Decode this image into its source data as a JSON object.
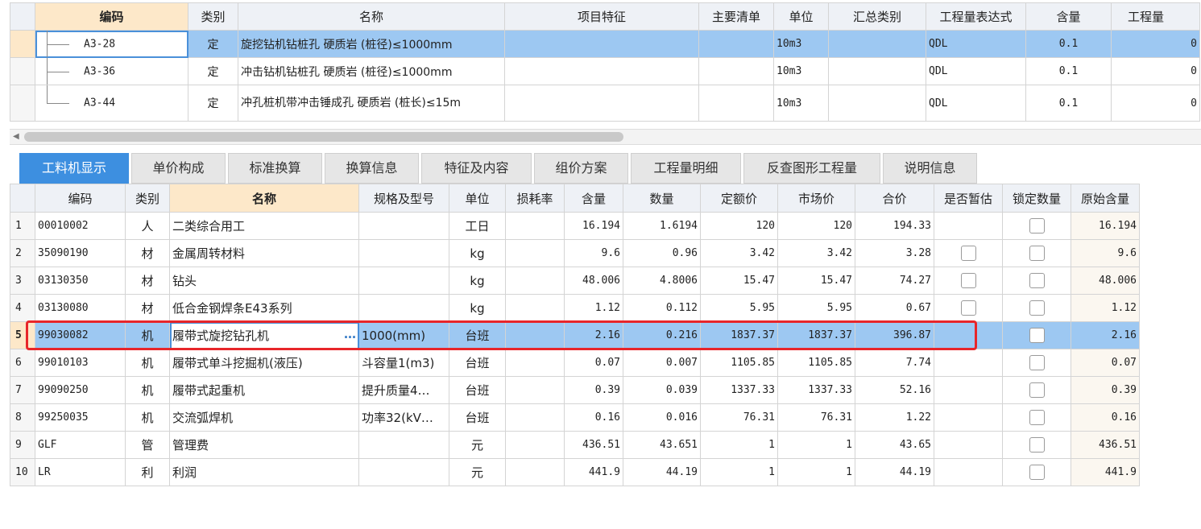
{
  "top_grid": {
    "headers": [
      "编码",
      "类别",
      "名称",
      "项目特征",
      "主要清单",
      "单位",
      "汇总类别",
      "工程量表达式",
      "含量",
      "工程量"
    ],
    "rows": [
      {
        "code": "A3-28",
        "type": "定",
        "name": "旋挖钻机钻桩孔 硬质岩 (桩径)≤1000mm",
        "feature": "",
        "main": "",
        "unit": "10m3",
        "summary": "",
        "expr": "QDL",
        "content": "0.1",
        "qty": "0"
      },
      {
        "code": "A3-36",
        "type": "定",
        "name": "冲击钻机钻桩孔 硬质岩 (桩径)≤1000mm",
        "feature": "",
        "main": "",
        "unit": "10m3",
        "summary": "",
        "expr": "QDL",
        "content": "0.1",
        "qty": "0"
      },
      {
        "code": "A3-44",
        "type": "定",
        "name": "冲孔桩机带冲击锤成孔 硬质岩 (桩长)≤15m",
        "feature": "",
        "main": "",
        "unit": "10m3",
        "summary": "",
        "expr": "QDL",
        "content": "0.1",
        "qty": "0"
      }
    ]
  },
  "tabs": [
    "工料机显示",
    "单价构成",
    "标准换算",
    "换算信息",
    "特征及内容",
    "组价方案",
    "工程量明细",
    "反查图形工程量",
    "说明信息"
  ],
  "bottom_grid": {
    "headers": [
      "编码",
      "类别",
      "名称",
      "规格及型号",
      "单位",
      "损耗率",
      "含量",
      "数量",
      "定额价",
      "市场价",
      "合价",
      "是否暂估",
      "锁定数量",
      "原始含量"
    ],
    "rows": [
      {
        "n": "1",
        "code": "00010002",
        "type": "人",
        "name": "二类综合用工",
        "spec": "",
        "unit": "工日",
        "loss": "",
        "content": "16.194",
        "qty": "1.6194",
        "quota": "120",
        "market": "120",
        "total": "194.33",
        "est": false,
        "lock": true,
        "orig": "16.194"
      },
      {
        "n": "2",
        "code": "35090190",
        "type": "材",
        "name": "金属周转材料",
        "spec": "",
        "unit": "kg",
        "loss": "",
        "content": "9.6",
        "qty": "0.96",
        "quota": "3.42",
        "market": "3.42",
        "total": "3.28",
        "est": true,
        "lock": true,
        "orig": "9.6"
      },
      {
        "n": "3",
        "code": "03130350",
        "type": "材",
        "name": "钻头",
        "spec": "",
        "unit": "kg",
        "loss": "",
        "content": "48.006",
        "qty": "4.8006",
        "quota": "15.47",
        "market": "15.47",
        "total": "74.27",
        "est": true,
        "lock": true,
        "orig": "48.006"
      },
      {
        "n": "4",
        "code": "03130080",
        "type": "材",
        "name": "低合金钢焊条E43系列",
        "spec": "",
        "unit": "kg",
        "loss": "",
        "content": "1.12",
        "qty": "0.112",
        "quota": "5.95",
        "market": "5.95",
        "total": "0.67",
        "est": true,
        "lock": true,
        "orig": "1.12"
      },
      {
        "n": "5",
        "code": "99030082",
        "type": "机",
        "name": "履带式旋挖钻孔机",
        "spec": "1000(mm)",
        "unit": "台班",
        "loss": "",
        "content": "2.16",
        "qty": "0.216",
        "quota": "1837.37",
        "market": "1837.37",
        "total": "396.87",
        "est": false,
        "lock": true,
        "orig": "2.16"
      },
      {
        "n": "6",
        "code": "99010103",
        "type": "机",
        "name": "履带式单斗挖掘机(液压)",
        "spec": "斗容量1(m3)",
        "unit": "台班",
        "loss": "",
        "content": "0.07",
        "qty": "0.007",
        "quota": "1105.85",
        "market": "1105.85",
        "total": "7.74",
        "est": false,
        "lock": true,
        "orig": "0.07"
      },
      {
        "n": "7",
        "code": "99090250",
        "type": "机",
        "name": "履带式起重机",
        "spec": "提升质量4…",
        "unit": "台班",
        "loss": "",
        "content": "0.39",
        "qty": "0.039",
        "quota": "1337.33",
        "market": "1337.33",
        "total": "52.16",
        "est": false,
        "lock": true,
        "orig": "0.39"
      },
      {
        "n": "8",
        "code": "99250035",
        "type": "机",
        "name": "交流弧焊机",
        "spec": "功率32(kV…",
        "unit": "台班",
        "loss": "",
        "content": "0.16",
        "qty": "0.016",
        "quota": "76.31",
        "market": "76.31",
        "total": "1.22",
        "est": false,
        "lock": true,
        "orig": "0.16"
      },
      {
        "n": "9",
        "code": "GLF",
        "type": "管",
        "name": "管理费",
        "spec": "",
        "unit": "元",
        "loss": "",
        "content": "436.51",
        "qty": "43.651",
        "quota": "1",
        "market": "1",
        "total": "43.65",
        "est": false,
        "lock": true,
        "orig": "436.51"
      },
      {
        "n": "10",
        "code": "LR",
        "type": "利",
        "name": "利润",
        "spec": "",
        "unit": "元",
        "loss": "",
        "content": "441.9",
        "qty": "44.19",
        "quota": "1",
        "market": "1",
        "total": "44.19",
        "est": false,
        "lock": true,
        "orig": "441.9"
      }
    ]
  },
  "icons": {
    "ellipsis": "…",
    "scroll_left": "◀"
  }
}
